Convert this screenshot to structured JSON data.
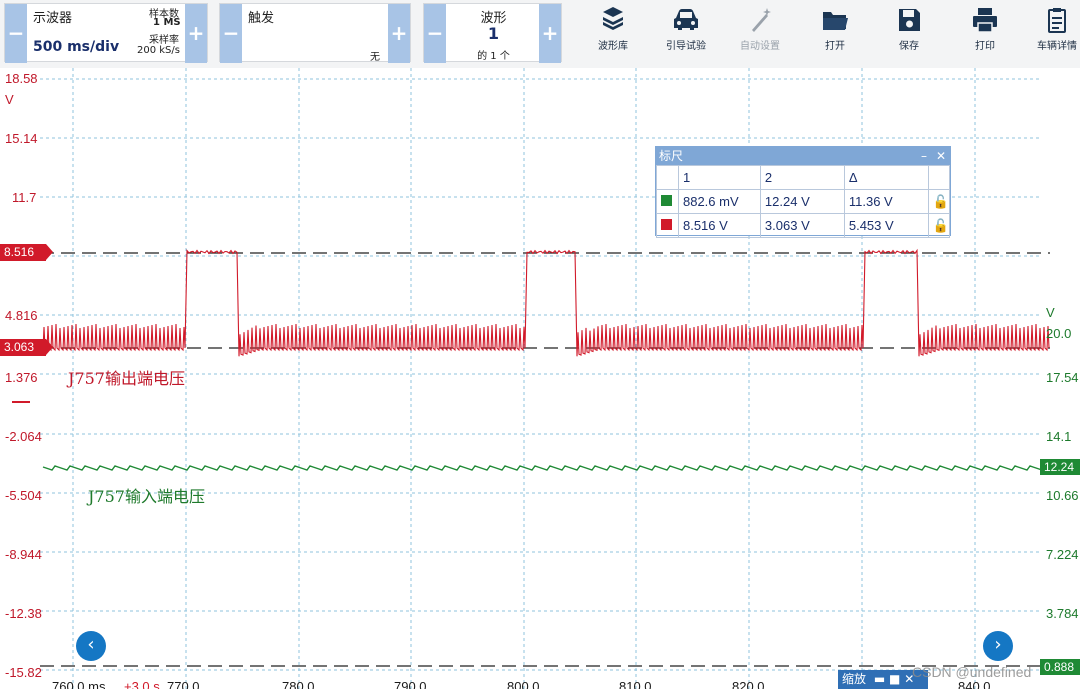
{
  "toolbar": {
    "oscilloscope": {
      "title": "示波器",
      "timebase": "500 ms/div",
      "samples_label": "样本数",
      "samples_value": "1 MS",
      "rate_label": "采样率",
      "rate_value": "200 kS/s"
    },
    "trigger": {
      "title": "触发",
      "mode": "无"
    },
    "waveform": {
      "title": "波形",
      "value": "1",
      "sub": "的 1 个"
    },
    "actions": [
      {
        "label": "波形库",
        "icon": "waveform-library-icon",
        "enabled": true
      },
      {
        "label": "引导试验",
        "icon": "car-icon",
        "enabled": true
      },
      {
        "label": "自动设置",
        "icon": "wand-icon",
        "enabled": false
      },
      {
        "label": "打开",
        "icon": "folder-icon",
        "enabled": true
      },
      {
        "label": "保存",
        "icon": "save-icon",
        "enabled": true
      },
      {
        "label": "打印",
        "icon": "print-icon",
        "enabled": true
      },
      {
        "label": "车辆详情",
        "icon": "clipboard-icon",
        "enabled": true
      }
    ]
  },
  "axes": {
    "left_unit": "V",
    "left_ticks": [
      "18.58",
      "15.14",
      "11.7",
      "4.816",
      "1.376",
      "-2.064",
      "-5.504",
      "-8.944",
      "-12.38",
      "-15.82"
    ],
    "right_unit": "V",
    "right_ticks": [
      "20.0",
      "17.54",
      "14.1",
      "10.66",
      "7.224",
      "3.784",
      "0.888"
    ],
    "x_ticks": [
      "760.0 ms",
      "770.0",
      "780.0",
      "790.0",
      "800.0",
      "810.0",
      "820.0",
      "840.0"
    ],
    "x_offset": "+3.0 s"
  },
  "markers": {
    "upper": "8.516",
    "lower": "3.063",
    "green": "12.24"
  },
  "traces": {
    "output": {
      "label": "J757输出端电压",
      "color": "#d11a2a"
    },
    "input": {
      "label": "J757输入端电压",
      "color": "#1f8a35"
    }
  },
  "ruler": {
    "title": "标尺",
    "headers": [
      "",
      "1",
      "2",
      "Δ",
      ""
    ],
    "rows": [
      {
        "color": "#1f8a35",
        "v1": "882.6 mV",
        "v2": "12.24 V",
        "delta": "11.36 V"
      },
      {
        "color": "#d11a2a",
        "v1": "8.516 V",
        "v2": "3.063 V",
        "delta": "5.453 V"
      }
    ]
  },
  "zoom": {
    "label": "缩放"
  },
  "watermark": "CSDN @undefined"
}
